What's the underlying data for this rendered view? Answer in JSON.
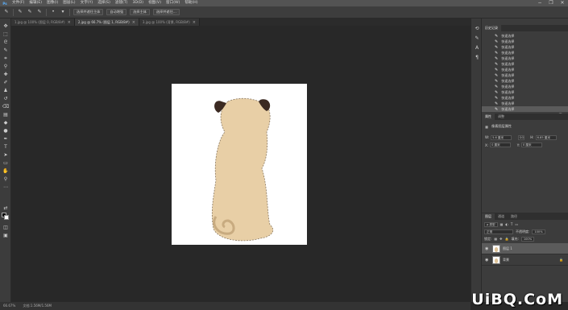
{
  "app": {
    "logo": "Ps"
  },
  "menu": {
    "items": [
      "文件(F)",
      "编辑(E)",
      "图像(I)",
      "图层(L)",
      "文字(Y)",
      "选择(S)",
      "滤镜(T)",
      "3D(D)",
      "视图(V)",
      "窗口(W)",
      "帮助(H)"
    ]
  },
  "window_controls": {
    "minimize": "−",
    "restore": "❐",
    "close": "✕"
  },
  "options_bar": {
    "select_subject": "选择并遮住主体",
    "auto_enhance": "自动增强",
    "sample_all": "选择主体",
    "select_and_mask": "选择并遮住..."
  },
  "tabs": [
    {
      "label": "1.jpg @ 100% (图层 0, RGB/8#)",
      "active": false
    },
    {
      "label": "2.jpg @ 66.7% (图层 1, RGB/8#)",
      "active": true
    },
    {
      "label": "3.jpg @ 100% (背景, RGB/8#)",
      "active": false
    }
  ],
  "history": {
    "tabs": [
      "历史记录"
    ],
    "items": [
      "快速选择",
      "快速选择",
      "快速选择",
      "快速选择",
      "快速选择",
      "快速选择",
      "快速选择",
      "快速选择",
      "快速选择",
      "快速选择",
      "快速选择",
      "快速选择",
      "快速选择",
      "快速选择"
    ],
    "selected_index": 13
  },
  "properties": {
    "tabs": [
      "属性",
      "调整"
    ],
    "title": "像素图层属性",
    "w_label": "W:",
    "w_value": "5.6 厘米",
    "h_label": "H:",
    "h_value": "6.85 厘米",
    "x_label": "X:",
    "x_value": "0 厘米",
    "y_label": "Y:",
    "y_value": "0 厘米",
    "link_label": "GO"
  },
  "layers": {
    "tabs": [
      "图层",
      "通道",
      "路径"
    ],
    "kind": "ρ 类型",
    "blend_mode": "正常",
    "opacity_label": "不透明度:",
    "opacity_value": "100%",
    "lock_label": "锁定:",
    "fill_label": "填充:",
    "fill_value": "100%",
    "items": [
      {
        "name": "图层 1",
        "selected": true
      },
      {
        "name": "背景",
        "selected": false
      }
    ]
  },
  "status": {
    "zoom": "66.67%",
    "doc": "文档:1.56M/1.56M"
  },
  "watermark": "UiBQ.CoM"
}
